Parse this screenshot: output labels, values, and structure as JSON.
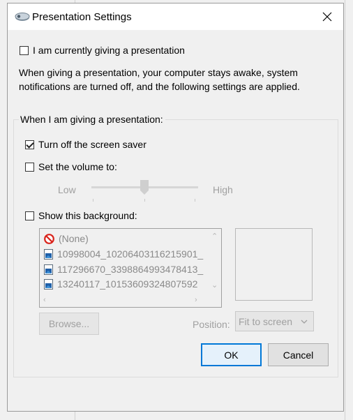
{
  "dialog": {
    "title": "Presentation Settings",
    "giving_presentation": {
      "label": "I am currently giving a presentation",
      "checked": false
    },
    "description": "When giving a presentation, your computer stays awake, system notifications are turned off, and the following settings are applied.",
    "group_title": "When I am giving a presentation:",
    "screen_saver": {
      "label": "Turn off the screen saver",
      "checked": true
    },
    "volume": {
      "label": "Set the volume to:",
      "checked": false,
      "low_label": "Low",
      "high_label": "High",
      "level": 0.5
    },
    "background": {
      "label": "Show this background:",
      "checked": false,
      "items": [
        {
          "text": "(None)",
          "icon": "no-entry-icon"
        },
        {
          "text": "10998004_10206403116215901_",
          "icon": "image-file-icon"
        },
        {
          "text": "117296670_3398864993478413_",
          "icon": "image-file-icon"
        },
        {
          "text": "13240117_10153609324807592",
          "icon": "image-file-icon"
        }
      ]
    },
    "browse_label": "Browse...",
    "position_label": "Position:",
    "position_value": "Fit to screen",
    "ok_label": "OK",
    "cancel_label": "Cancel"
  },
  "colors": {
    "accent": "#0078d7",
    "disabled_text": "#a0a0a0",
    "dialog_bg": "#f0f0f0"
  }
}
